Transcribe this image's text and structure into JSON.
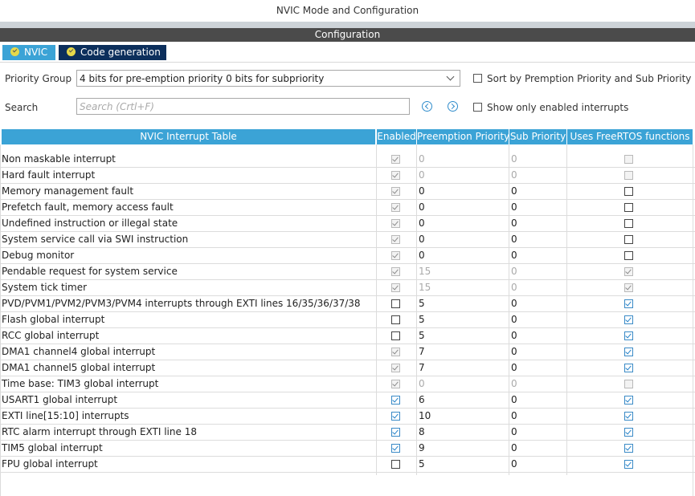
{
  "window": {
    "title": "NVIC Mode and Configuration"
  },
  "config_bar": {
    "label": "Configuration"
  },
  "tabs": [
    {
      "label": "NVIC",
      "active": true
    },
    {
      "label": "Code generation",
      "active": false
    }
  ],
  "priority_group": {
    "label": "Priority Group",
    "value": "4 bits for pre-emption priority 0 bits for subpriority"
  },
  "sort_option": {
    "label": "Sort by Premption Priority and Sub Priority",
    "checked": false
  },
  "search": {
    "label": "Search",
    "placeholder": "Search (Crtl+F)",
    "value": ""
  },
  "show_enabled_option": {
    "label": "Show only enabled interrupts",
    "checked": false
  },
  "table": {
    "columns": [
      "NVIC Interrupt Table",
      "Enabled",
      "Preemption Priority",
      "Sub Priority",
      "Uses FreeRTOS functions"
    ],
    "rows": [
      {
        "name": "Non maskable interrupt",
        "enabled": true,
        "enabled_locked": true,
        "preemption": "0",
        "sub": "0",
        "prio_dim": true,
        "freertos": false,
        "freertos_locked": true
      },
      {
        "name": "Hard fault interrupt",
        "enabled": true,
        "enabled_locked": true,
        "preemption": "0",
        "sub": "0",
        "prio_dim": true,
        "freertos": false,
        "freertos_locked": true
      },
      {
        "name": "Memory management fault",
        "enabled": true,
        "enabled_locked": true,
        "preemption": "0",
        "sub": "0",
        "prio_dim": false,
        "freertos": false,
        "freertos_locked": false
      },
      {
        "name": "Prefetch fault, memory access fault",
        "enabled": true,
        "enabled_locked": true,
        "preemption": "0",
        "sub": "0",
        "prio_dim": false,
        "freertos": false,
        "freertos_locked": false
      },
      {
        "name": "Undefined instruction or illegal state",
        "enabled": true,
        "enabled_locked": true,
        "preemption": "0",
        "sub": "0",
        "prio_dim": false,
        "freertos": false,
        "freertos_locked": false
      },
      {
        "name": "System service call via SWI instruction",
        "enabled": true,
        "enabled_locked": true,
        "preemption": "0",
        "sub": "0",
        "prio_dim": false,
        "freertos": false,
        "freertos_locked": false
      },
      {
        "name": "Debug monitor",
        "enabled": true,
        "enabled_locked": true,
        "preemption": "0",
        "sub": "0",
        "prio_dim": false,
        "freertos": false,
        "freertos_locked": false
      },
      {
        "name": "Pendable request for system service",
        "enabled": true,
        "enabled_locked": true,
        "preemption": "15",
        "sub": "0",
        "prio_dim": true,
        "freertos": true,
        "freertos_locked": true
      },
      {
        "name": "System tick timer",
        "enabled": true,
        "enabled_locked": true,
        "preemption": "15",
        "sub": "0",
        "prio_dim": true,
        "freertos": true,
        "freertos_locked": true
      },
      {
        "name": "PVD/PVM1/PVM2/PVM3/PVM4 interrupts through EXTI lines 16/35/36/37/38",
        "enabled": false,
        "enabled_locked": false,
        "preemption": "5",
        "sub": "0",
        "prio_dim": false,
        "freertos": true,
        "freertos_locked": false
      },
      {
        "name": "Flash global interrupt",
        "enabled": false,
        "enabled_locked": false,
        "preemption": "5",
        "sub": "0",
        "prio_dim": false,
        "freertos": true,
        "freertos_locked": false
      },
      {
        "name": "RCC global interrupt",
        "enabled": false,
        "enabled_locked": false,
        "preemption": "5",
        "sub": "0",
        "prio_dim": false,
        "freertos": true,
        "freertos_locked": false
      },
      {
        "name": "DMA1 channel4 global interrupt",
        "enabled": true,
        "enabled_locked": true,
        "preemption": "7",
        "sub": "0",
        "prio_dim": false,
        "freertos": true,
        "freertos_locked": false
      },
      {
        "name": "DMA1 channel5 global interrupt",
        "enabled": true,
        "enabled_locked": true,
        "preemption": "7",
        "sub": "0",
        "prio_dim": false,
        "freertos": true,
        "freertos_locked": false
      },
      {
        "name": "Time base: TIM3 global interrupt",
        "enabled": true,
        "enabled_locked": true,
        "preemption": "0",
        "sub": "0",
        "prio_dim": true,
        "freertos": false,
        "freertos_locked": true
      },
      {
        "name": "USART1 global interrupt",
        "enabled": true,
        "enabled_locked": false,
        "preemption": "6",
        "sub": "0",
        "prio_dim": false,
        "freertos": true,
        "freertos_locked": false
      },
      {
        "name": "EXTI line[15:10] interrupts",
        "enabled": true,
        "enabled_locked": false,
        "preemption": "10",
        "sub": "0",
        "prio_dim": false,
        "freertos": true,
        "freertos_locked": false
      },
      {
        "name": "RTC alarm interrupt through EXTI line 18",
        "enabled": true,
        "enabled_locked": false,
        "preemption": "8",
        "sub": "0",
        "prio_dim": false,
        "freertos": true,
        "freertos_locked": false
      },
      {
        "name": "TIM5 global interrupt",
        "enabled": true,
        "enabled_locked": false,
        "preemption": "9",
        "sub": "0",
        "prio_dim": false,
        "freertos": true,
        "freertos_locked": false
      },
      {
        "name": "FPU global interrupt",
        "enabled": false,
        "enabled_locked": false,
        "preemption": "5",
        "sub": "0",
        "prio_dim": false,
        "freertos": true,
        "freertos_locked": false
      }
    ]
  },
  "colors": {
    "accent": "#3ba3d6",
    "tab_dark": "#0c2f5c",
    "header_bar": "#4b4b4b",
    "check": "#2683c9"
  }
}
